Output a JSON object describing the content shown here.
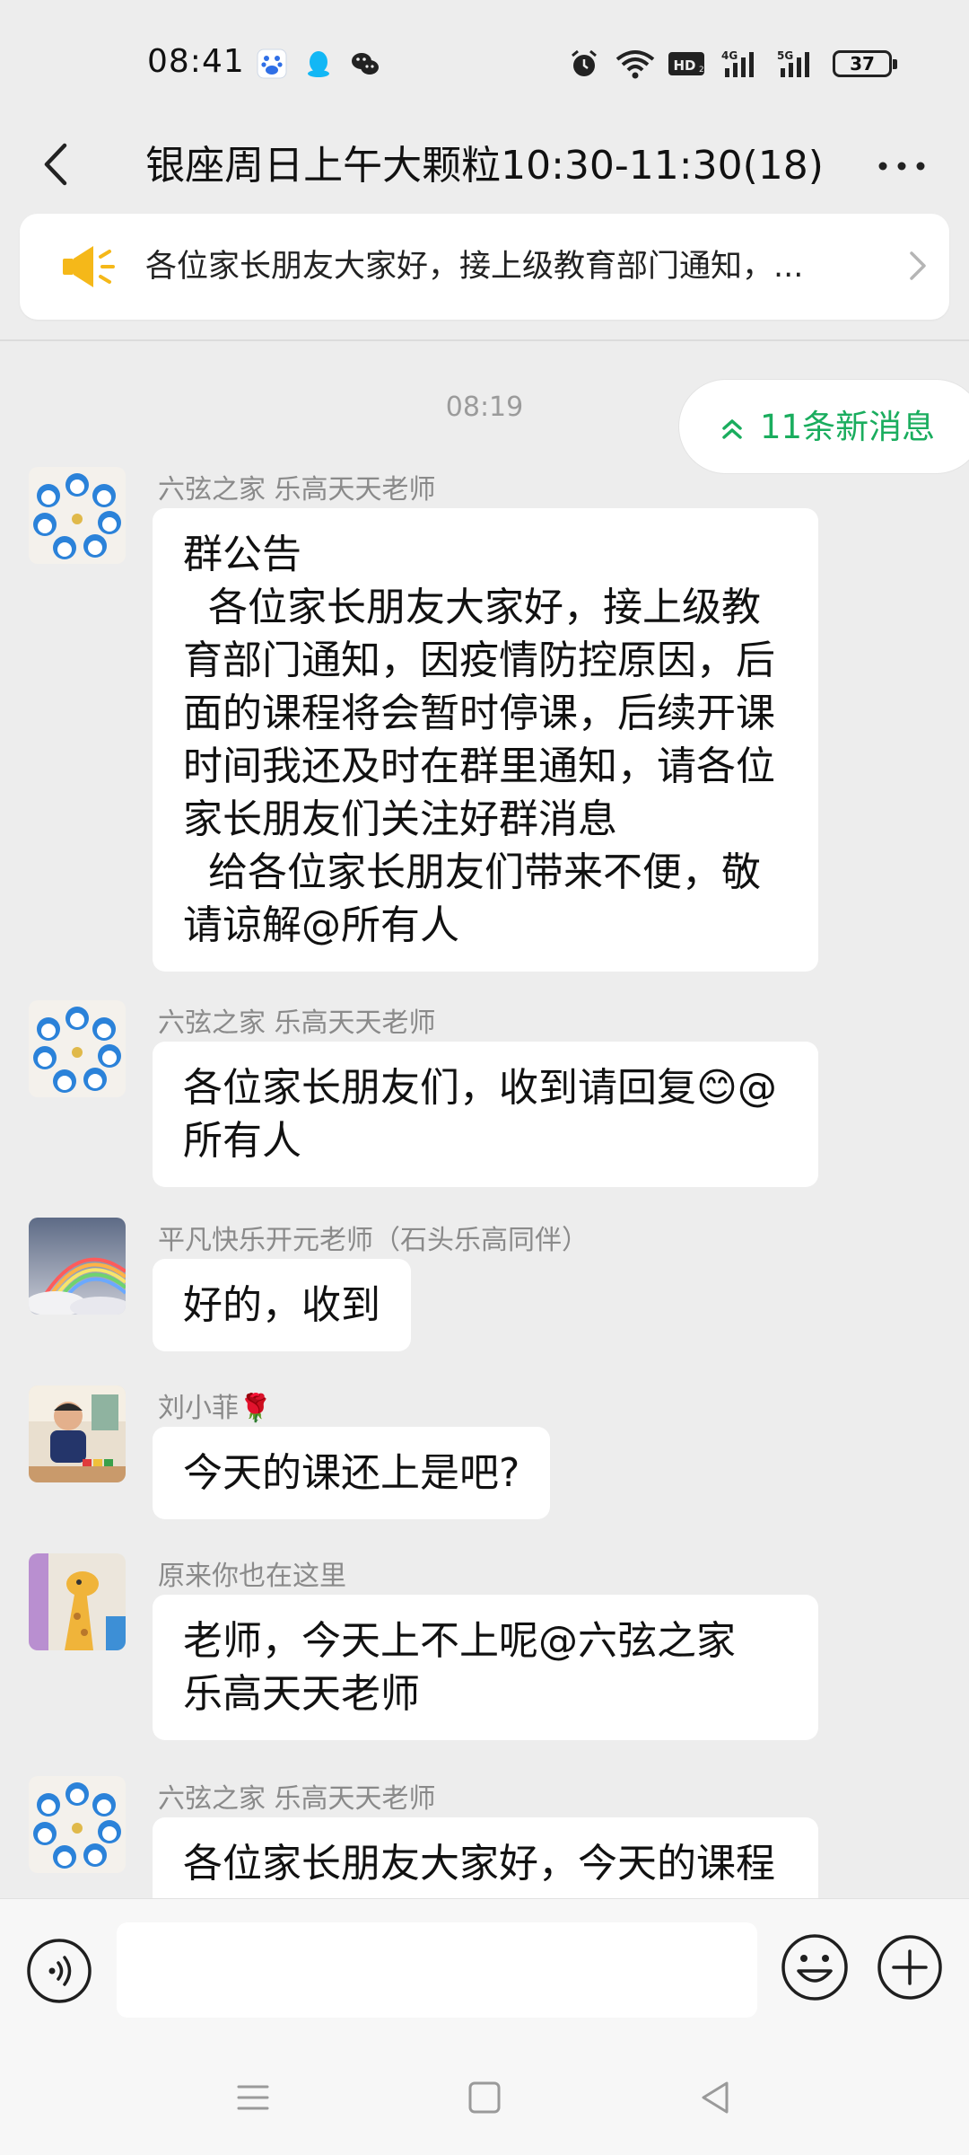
{
  "status_bar": {
    "time": "08:41",
    "battery_level": "37",
    "icons": [
      "baidu-icon",
      "qq-icon",
      "wechat-icon",
      "alarm-icon",
      "wifi-icon",
      "hd-icon",
      "signal-4g-icon",
      "signal-5g-icon",
      "battery-icon"
    ]
  },
  "header": {
    "back_icon": "chevron-left-icon",
    "title": "银座周日上午大颗粒10:30-11:30(18)",
    "more_icon": "more-horizontal-icon"
  },
  "pinned": {
    "icon": "megaphone-icon",
    "text": "各位家长朋友大家好，接上级教育部门通知，...",
    "color": "#f5b819"
  },
  "chat": {
    "timestamp": "08:19",
    "new_messages_label": "11条新消息",
    "accent": "#1aad5e",
    "messages": [
      {
        "sender": "六弦之家  乐高天天老师",
        "avatar": "doraemon-avatar",
        "text": "群公告\n  各位家长朋友大家好，接上级教育部门通知，因疫情防控原因，后面的课程将会暂时停课，后续开课时间我还及时在群里通知，请各位家长朋友们关注好群消息\n  给各位家长朋友们带来不便，敬请谅解@所有人"
      },
      {
        "sender": "六弦之家  乐高天天老师",
        "avatar": "doraemon-avatar",
        "text": "各位家长朋友们，收到请回复😊@所有人"
      },
      {
        "sender": "平凡快乐开元老师（石头乐高同伴）",
        "avatar": "rainbow-avatar",
        "text": "好的，收到"
      },
      {
        "sender": "刘小菲🌹",
        "avatar": "child-photo-avatar",
        "text": "今天的课还上是吧?"
      },
      {
        "sender": "原来你也在这里",
        "avatar": "giraffe-avatar",
        "text": "老师，今天上不上呢@六弦之家  乐高天天老师"
      },
      {
        "sender": "六弦之家  乐高天天老师",
        "avatar": "doraemon-avatar",
        "text": "各位家长朋友大家好，今天的课程"
      }
    ]
  },
  "input_bar": {
    "value": "",
    "voice_icon": "voice-icon",
    "emoji_icon": "emoji-icon",
    "plus_icon": "plus-icon"
  },
  "nav_bar": {
    "icons": [
      "menu-icon",
      "home-square-icon",
      "back-triangle-icon"
    ]
  }
}
